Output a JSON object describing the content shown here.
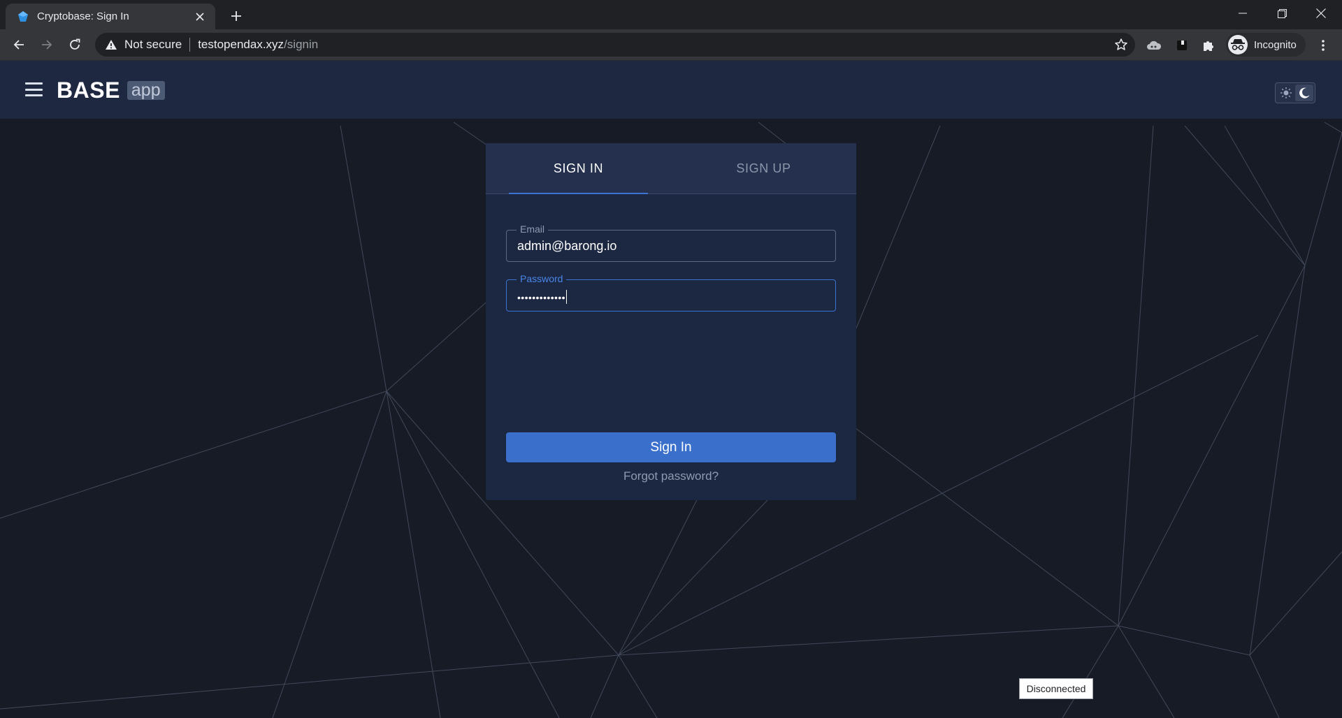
{
  "browser": {
    "tab_title": "Cryptobase: Sign In",
    "security_label": "Not secure",
    "url_host": "testopendax.xyz",
    "url_path": "/signin",
    "profile_label": "Incognito"
  },
  "header": {
    "logo_primary": "BASE",
    "logo_secondary": "app"
  },
  "auth": {
    "tabs": [
      {
        "label": "SIGN IN",
        "active": true
      },
      {
        "label": "SIGN UP",
        "active": false
      }
    ],
    "email": {
      "label": "Email",
      "value": "admin@barong.io"
    },
    "password": {
      "label": "Password",
      "masked_value": "•••••••••••••"
    },
    "submit_label": "Sign In",
    "forgot_label": "Forgot password?"
  },
  "status": {
    "connection": "Disconnected"
  },
  "colors": {
    "accent": "#3a6fcc",
    "header_bg": "#1e2841",
    "page_bg": "#161b26",
    "card_bg": "#1c2742"
  }
}
